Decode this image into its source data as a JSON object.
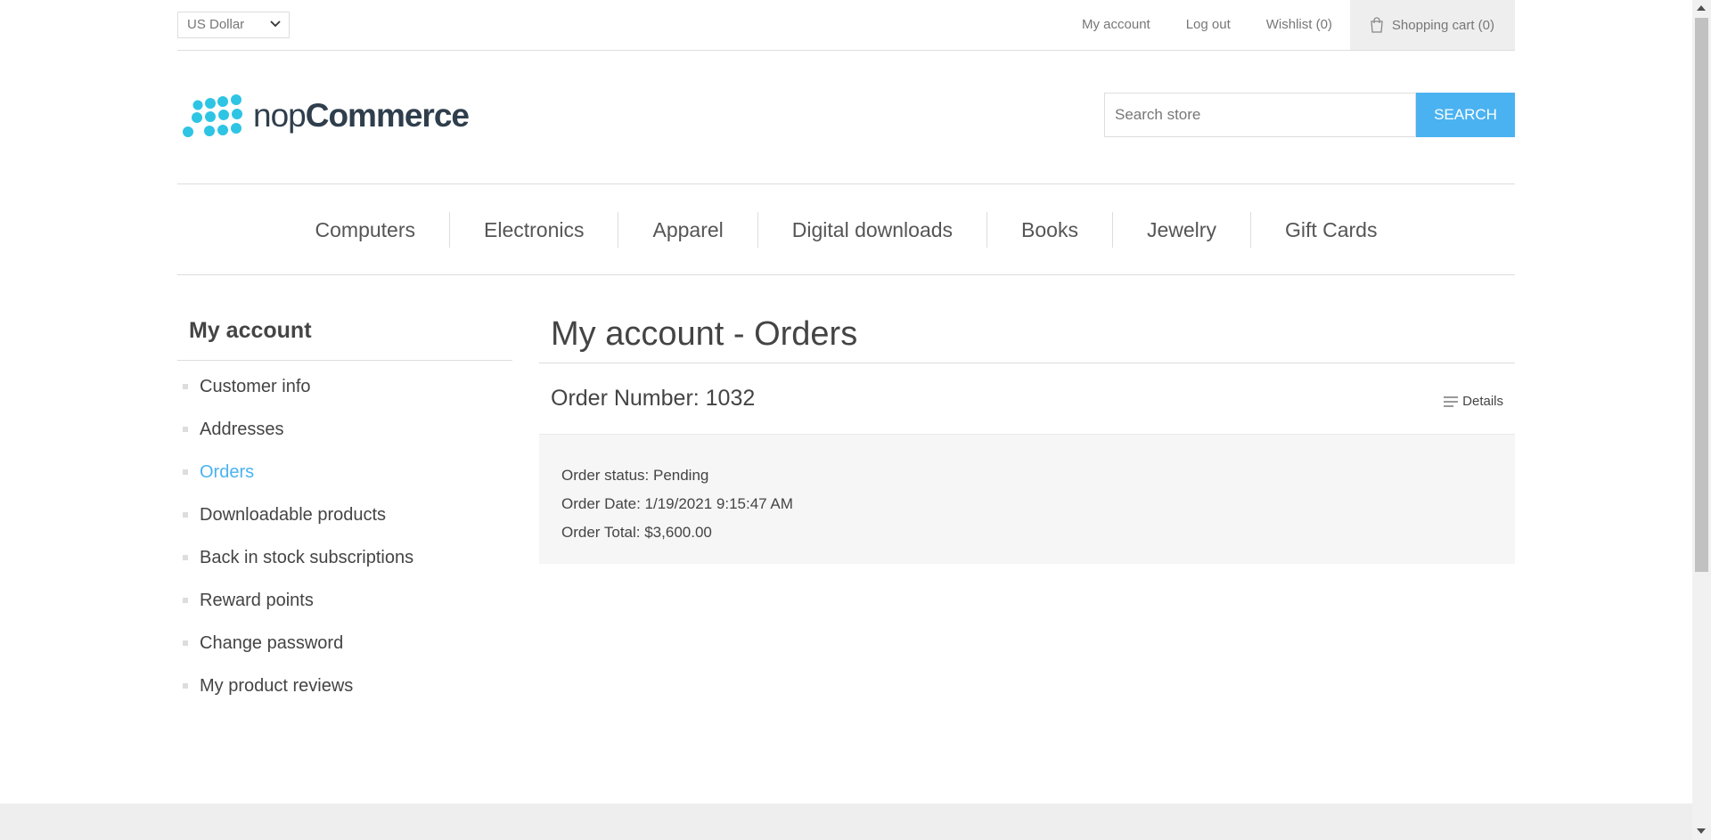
{
  "header": {
    "currency": "US Dollar",
    "links": [
      "My account",
      "Log out",
      "Wishlist (0)"
    ],
    "cart": "Shopping cart (0)"
  },
  "logo": {
    "prefix": "nop",
    "brand": "Commerce",
    "color": "#2ec4e4"
  },
  "search": {
    "placeholder": "Search store",
    "button": "Search"
  },
  "menu": {
    "items": [
      "Computers",
      "Electronics",
      "Apparel",
      "Digital downloads",
      "Books",
      "Jewelry",
      "Gift Cards"
    ]
  },
  "sidebar": {
    "title": "My account",
    "items": [
      {
        "label": "Customer info"
      },
      {
        "label": "Addresses"
      },
      {
        "label": "Orders",
        "active": true
      },
      {
        "label": "Downloadable products"
      },
      {
        "label": "Back in stock subscriptions"
      },
      {
        "label": "Reward points"
      },
      {
        "label": "Change password"
      },
      {
        "label": "My product reviews"
      }
    ]
  },
  "main": {
    "title": "My account - Orders",
    "order": {
      "title": "Order Number: 1032",
      "details_label": "Details",
      "status": "Order status: Pending",
      "date": "Order Date: 1/19/2021 9:15:47 AM",
      "total": "Order Total: $3,600.00"
    }
  },
  "colors": {
    "accent": "#4ab2f1",
    "text": "#444444",
    "muted": "#777777",
    "panel": "#f6f6f6"
  }
}
